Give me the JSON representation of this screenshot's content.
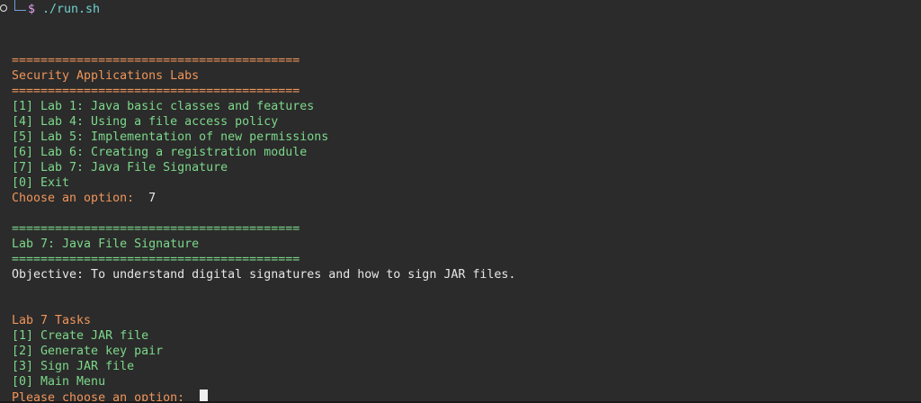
{
  "colors": {
    "background": "#2b2b2b",
    "orange": "#f0955a",
    "green": "#7cd88a",
    "white": "#e6e6e6",
    "prompt_path": "#6fd3d0"
  },
  "prompt": {
    "symbol": "$",
    "command": " ./run.sh"
  },
  "menu": {
    "rule": "========================================",
    "title": "Security Applications Labs",
    "items": [
      "[1] Lab 1: Java basic classes and features",
      "[4] Lab 4: Using a file access policy",
      "[5] Lab 5: Implementation of new permissions",
      "[6] Lab 6: Creating a registration module",
      "[7] Lab 7: Java File Signature",
      "[0] Exit"
    ],
    "choose_label": "Choose an option: ",
    "choose_value": " 7"
  },
  "lab": {
    "rule": "========================================",
    "title": "Lab 7: Java File Signature",
    "objective": "Objective: To understand digital signatures and how to sign JAR files.",
    "tasks_header": "Lab 7 Tasks",
    "tasks": [
      "[1] Create JAR file",
      "[2] Generate key pair",
      "[3] Sign JAR file",
      "[0] Main Menu"
    ],
    "prompt_label": "Please choose an option: "
  }
}
